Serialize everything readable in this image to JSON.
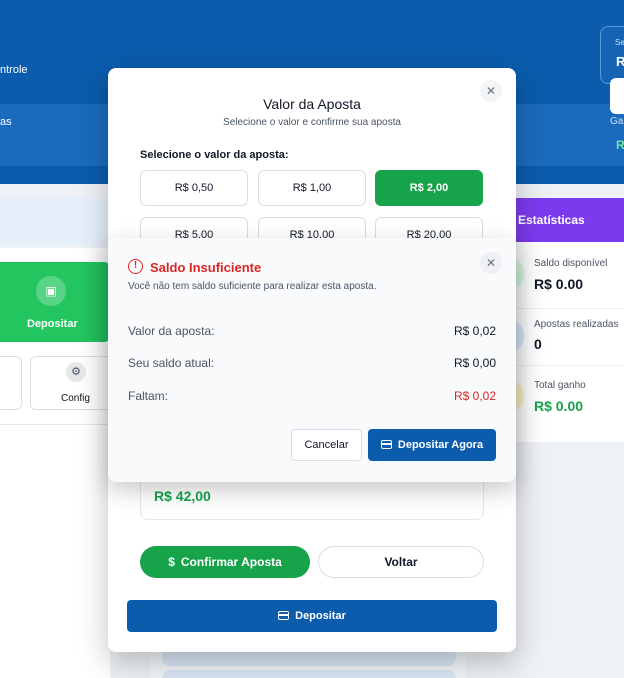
{
  "header": {
    "left_label": "ntrole",
    "left_label2": "as",
    "right_se": "Se",
    "right_r": "R",
    "right_ga": "Ga",
    "right_r2": "R"
  },
  "sidebar": {
    "deposit_label": "Depositar",
    "config_label": "Config"
  },
  "stats": {
    "title": "Estatísticas",
    "items": [
      {
        "label": "Saldo disponível",
        "value": "R$ 0.00",
        "color": "#22c55e"
      },
      {
        "label": "Apostas realizadas",
        "value": "0",
        "color": "#3b82f6"
      },
      {
        "label": "Total ganho",
        "value": "R$ 0.00",
        "color": "#eab308"
      }
    ]
  },
  "bet_modal": {
    "title": "Valor da Aposta",
    "subtitle": "Selecione o valor e confirme sua aposta",
    "select_label": "Selecione o valor da aposta:",
    "amounts": [
      "R$ 0,50",
      "R$ 1,00",
      "R$ 2,00",
      "R$ 5,00",
      "R$ 10,00",
      "R$ 20,00"
    ],
    "selected_amount": "R$ 2,00",
    "total_value": "R$ 42,00",
    "confirm_label": "Confirmar Aposta",
    "back_label": "Voltar",
    "deposit_label": "Depositar",
    "close_glyph": "✕"
  },
  "alert": {
    "title": "Saldo Insuficiente",
    "message": "Você não tem saldo suficiente para realizar esta aposta.",
    "rows": [
      {
        "label": "Valor da aposta:",
        "value": "R$ 0,02"
      },
      {
        "label": "Seu saldo atual:",
        "value": "R$ 0,00"
      },
      {
        "label": "Faltam:",
        "value": "R$ 0,02"
      }
    ],
    "cancel_label": "Cancelar",
    "deposit_now_label": "Depositar Agora",
    "close_glyph": "✕",
    "icon_glyph": "!"
  },
  "colors": {
    "brand_blue": "#0b5cad",
    "success_green": "#16a34a",
    "danger_red": "#dc2626",
    "stats_purple": "#7c3aed"
  }
}
